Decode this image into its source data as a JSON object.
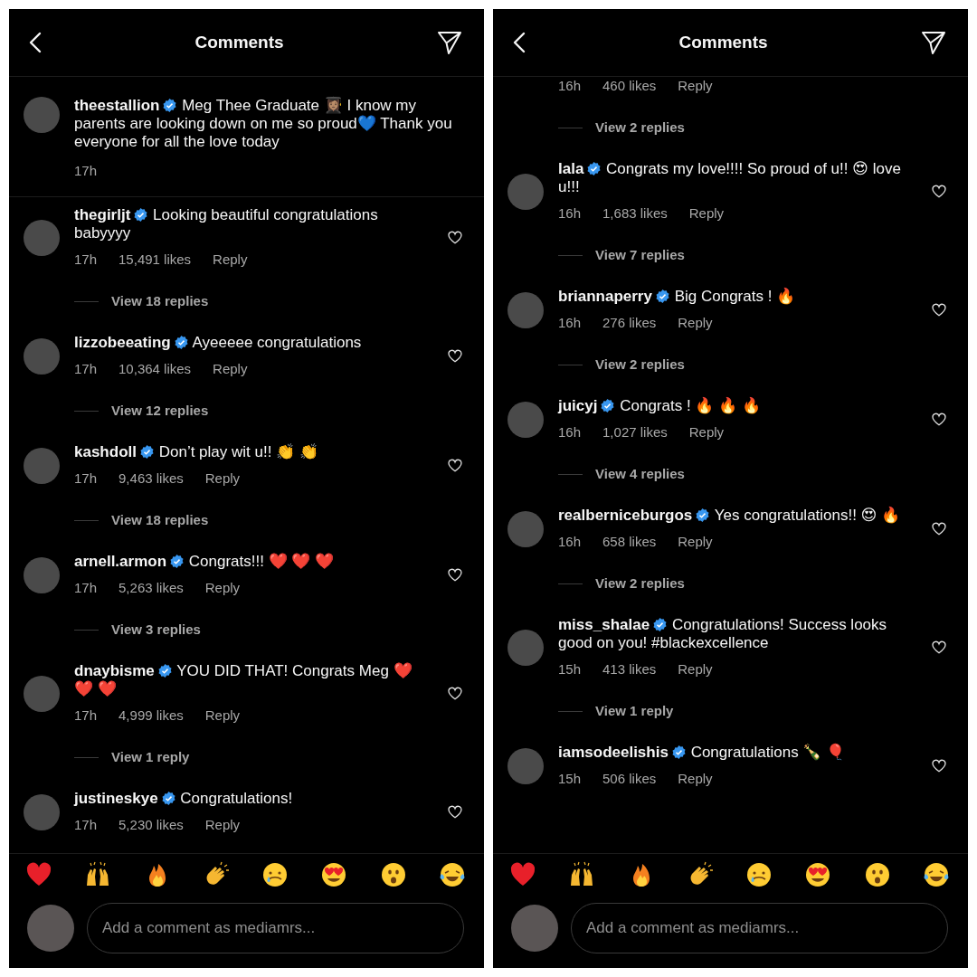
{
  "panels": [
    {
      "title": "Comments",
      "caption": {
        "user": "theestallion",
        "verified": true,
        "text": "Meg Thee Graduate 👩🏽‍🎓 I know my parents are looking down on me so proud💙 Thank you everyone for all the love today",
        "time": "17h"
      },
      "comments": [
        {
          "kind": "comment",
          "user": "thegirljt",
          "verified": true,
          "text": "Looking beautiful congratulations babyyyy",
          "time": "17h",
          "likes": "15,491 likes",
          "reply": "Reply",
          "replies": "View 18 replies"
        },
        {
          "kind": "comment",
          "user": "lizzobeeating",
          "verified": true,
          "text": "Ayeeeee congratulations",
          "time": "17h",
          "likes": "10,364 likes",
          "reply": "Reply",
          "replies": "View 12 replies"
        },
        {
          "kind": "comment",
          "user": "kashdoll",
          "verified": true,
          "text": "Don’t play wit u!! 👏 👏",
          "time": "17h",
          "likes": "9,463 likes",
          "reply": "Reply",
          "replies": "View 18 replies"
        },
        {
          "kind": "comment",
          "user": "arnell.armon",
          "verified": true,
          "text": "Congrats!!! ❤️ ❤️ ❤️",
          "time": "17h",
          "likes": "5,263 likes",
          "reply": "Reply",
          "replies": "View 3 replies"
        },
        {
          "kind": "comment",
          "user": "dnaybisme",
          "verified": true,
          "text": "YOU DID THAT! Congrats Meg ❤️ ❤️ ❤️",
          "time": "17h",
          "likes": "4,999 likes",
          "reply": "Reply",
          "replies": "View 1 reply"
        },
        {
          "kind": "comment",
          "user": "justineskye",
          "verified": true,
          "text": "Congratulations!",
          "time": "17h",
          "likes": "5,230 likes",
          "reply": "Reply"
        }
      ],
      "reactions": [
        {
          "kind": "heart"
        },
        {
          "kind": "raised-hands"
        },
        {
          "kind": "fire"
        },
        {
          "kind": "clapping"
        },
        {
          "kind": "crying"
        },
        {
          "kind": "heart-eyes"
        },
        {
          "kind": "surprised"
        },
        {
          "kind": "tears-of-joy"
        }
      ],
      "composer": {
        "placeholder": "Add a comment as mediamrs..."
      }
    },
    {
      "title": "Comments",
      "comments": [
        {
          "kind": "tail",
          "time": "16h",
          "likes": "460 likes",
          "reply": "Reply",
          "replies": "View 2 replies"
        },
        {
          "kind": "comment",
          "user": "lala",
          "verified": true,
          "text": "Congrats my love!!!! So proud of u!! 😍 love u!!!",
          "time": "16h",
          "likes": "1,683 likes",
          "reply": "Reply",
          "replies": "View 7 replies"
        },
        {
          "kind": "comment",
          "user": "briannaperry",
          "verified": true,
          "text": "Big Congrats ! 🔥",
          "time": "16h",
          "likes": "276 likes",
          "reply": "Reply",
          "replies": "View 2 replies"
        },
        {
          "kind": "comment",
          "user": "juicyj",
          "verified": true,
          "text": "Congrats ! 🔥 🔥 🔥",
          "time": "16h",
          "likes": "1,027 likes",
          "reply": "Reply",
          "replies": "View 4 replies"
        },
        {
          "kind": "comment",
          "user": "realberniceburgos",
          "verified": true,
          "text": "Yes congratulations!! 😍 🔥",
          "time": "16h",
          "likes": "658 likes",
          "reply": "Reply",
          "replies": "View 2 replies"
        },
        {
          "kind": "comment",
          "user": "miss_shalae",
          "verified": true,
          "text": "Congratulations! Success looks good on you! #blackexcellence",
          "time": "15h",
          "likes": "413 likes",
          "reply": "Reply",
          "replies": "View 1 reply"
        },
        {
          "kind": "comment",
          "user": "iamsodeelishis",
          "verified": true,
          "text": "Congratulations 🍾 🎈",
          "time": "15h",
          "likes": "506 likes",
          "reply": "Reply"
        }
      ],
      "reactions": [
        {
          "kind": "heart"
        },
        {
          "kind": "raised-hands"
        },
        {
          "kind": "fire"
        },
        {
          "kind": "clapping"
        },
        {
          "kind": "crying"
        },
        {
          "kind": "heart-eyes"
        },
        {
          "kind": "surprised"
        },
        {
          "kind": "tears-of-joy"
        }
      ],
      "composer": {
        "placeholder": "Add a comment as mediamrs..."
      }
    }
  ]
}
